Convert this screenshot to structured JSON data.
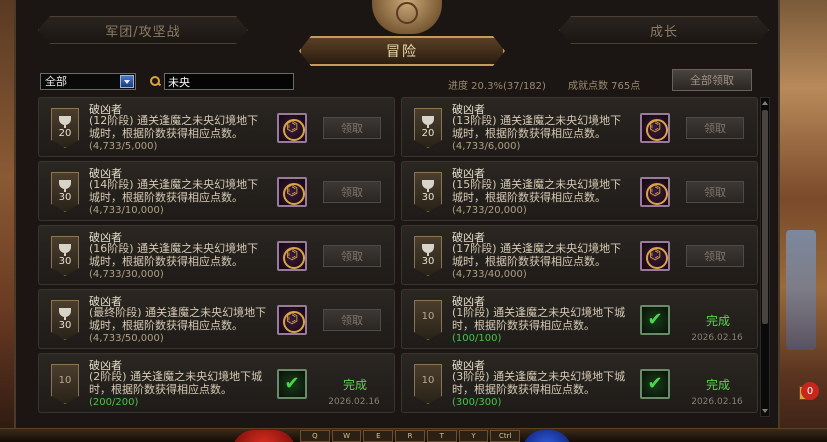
{
  "tabs": {
    "left": "军团/攻坚战",
    "active": "冒险",
    "right": "成长"
  },
  "filter": {
    "category": "全部",
    "search_value": "未央"
  },
  "stats": {
    "progress": "进度 20.3%(37/182)",
    "points": "成就点数 765点"
  },
  "claim_all": "全部领取",
  "achievements": [
    {
      "title": "破凶者",
      "desc": "(12阶段) 通关逢魔之未央幻境地下城时，根据阶数获得相应点数。",
      "count": "(4,733/5,000)",
      "points": "20",
      "status": "claim",
      "claim_label": "领取"
    },
    {
      "title": "破凶者",
      "desc": "(13阶段) 通关逢魔之未央幻境地下城时，根据阶数获得相应点数。",
      "count": "(4,733/6,000)",
      "points": "20",
      "status": "claim",
      "claim_label": "领取"
    },
    {
      "title": "破凶者",
      "desc": "(14阶段) 通关逢魔之未央幻境地下城时，根据阶数获得相应点数。",
      "count": "(4,733/10,000)",
      "points": "30",
      "status": "claim",
      "claim_label": "领取"
    },
    {
      "title": "破凶者",
      "desc": "(15阶段) 通关逢魔之未央幻境地下城时，根据阶数获得相应点数。",
      "count": "(4,733/20,000)",
      "points": "30",
      "status": "claim",
      "claim_label": "领取"
    },
    {
      "title": "破凶者",
      "desc": "(16阶段) 通关逢魔之未央幻境地下城时，根据阶数获得相应点数。",
      "count": "(4,733/30,000)",
      "points": "30",
      "status": "claim",
      "claim_label": "领取"
    },
    {
      "title": "破凶者",
      "desc": "(17阶段) 通关逢魔之未央幻境地下城时，根据阶数获得相应点数。",
      "count": "(4,733/40,000)",
      "points": "30",
      "status": "claim",
      "claim_label": "领取"
    },
    {
      "title": "破凶者",
      "desc": "(最终阶段) 通关逢魔之未央幻境地下城时，根据阶数获得相应点数。",
      "count": "(4,733/50,000)",
      "points": "30",
      "status": "claim",
      "claim_label": "领取"
    },
    {
      "title": "破凶者",
      "desc": "(1阶段) 通关逢魔之未央幻境地下城时，根据阶数获得相应点数。",
      "count": "(100/100)",
      "points": "10",
      "status": "done",
      "done_label": "完成",
      "date": "2026.02.16"
    },
    {
      "title": "破凶者",
      "desc": "(2阶段) 通关逢魔之未央幻境地下城时，根据阶数获得相应点数。",
      "count": "(200/200)",
      "points": "10",
      "status": "done",
      "done_label": "完成",
      "date": "2026.02.16"
    },
    {
      "title": "破凶者",
      "desc": "(3阶段) 通关逢魔之未央幻境地下城时，根据阶数获得相应点数。",
      "count": "(300/300)",
      "points": "10",
      "status": "done",
      "done_label": "完成",
      "date": "2026.02.16"
    }
  ],
  "side_badge": "0",
  "hotkeys": [
    "Q",
    "W",
    "E",
    "R",
    "T",
    "Y",
    "Ctrl"
  ],
  "colors": {
    "done_green": "#5ad84a",
    "accent_gold": "#c89a5a"
  }
}
